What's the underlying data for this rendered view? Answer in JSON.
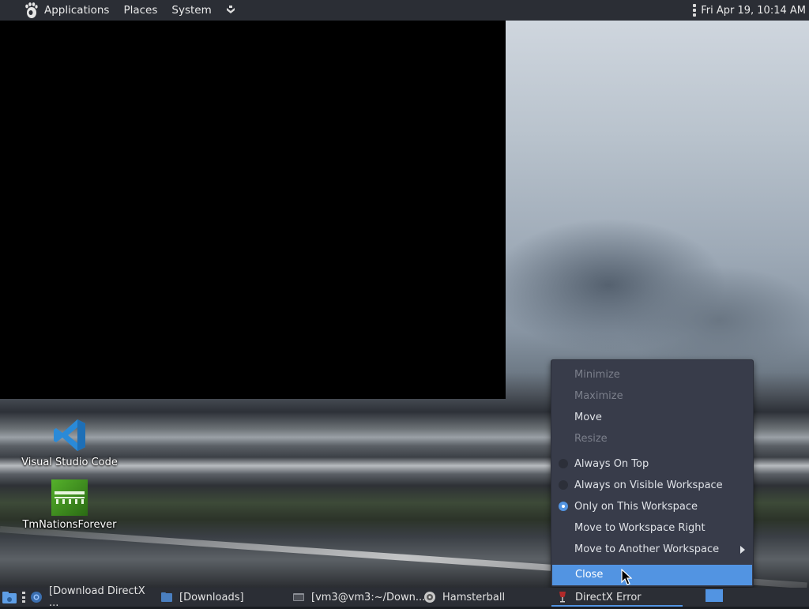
{
  "top_panel": {
    "menus": [
      "Applications",
      "Places",
      "System"
    ],
    "clock": "Fri Apr 19, 10:14 AM"
  },
  "desktop_icons": [
    {
      "label": "Visual Studio Code",
      "icon": "vscode-icon"
    },
    {
      "label": "TmNationsForever",
      "icon": "tmnations-icon"
    }
  ],
  "window_menu": {
    "items": [
      {
        "label": "Minimize",
        "state": "disabled"
      },
      {
        "label": "Maximize",
        "state": "disabled"
      },
      {
        "label": "Move",
        "state": "normal"
      },
      {
        "label": "Resize",
        "state": "disabled"
      },
      {
        "label": "Always On Top",
        "state": "radio-off"
      },
      {
        "label": "Always on Visible Workspace",
        "state": "radio-off"
      },
      {
        "label": "Only on This Workspace",
        "state": "radio-on"
      },
      {
        "label": "Move to Workspace Right",
        "state": "normal"
      },
      {
        "label": "Move to Another Workspace",
        "state": "submenu"
      },
      {
        "label": "Close",
        "state": "highlighted"
      }
    ]
  },
  "taskbar": {
    "tasks": [
      {
        "label": "[Download DirectX ...",
        "icon": "browser-icon"
      },
      {
        "label": "[Downloads]",
        "icon": "folder-icon"
      },
      {
        "label": "[vm3@vm3:~/Down...",
        "icon": "terminal-icon"
      },
      {
        "label": "Hamsterball",
        "icon": "hamsterball-icon"
      },
      {
        "label": "DirectX Error",
        "icon": "wine-icon",
        "active": true
      }
    ]
  },
  "colors": {
    "panel": "#2b2e35",
    "menu_bg": "#383c4a",
    "accent": "#5294e2"
  }
}
